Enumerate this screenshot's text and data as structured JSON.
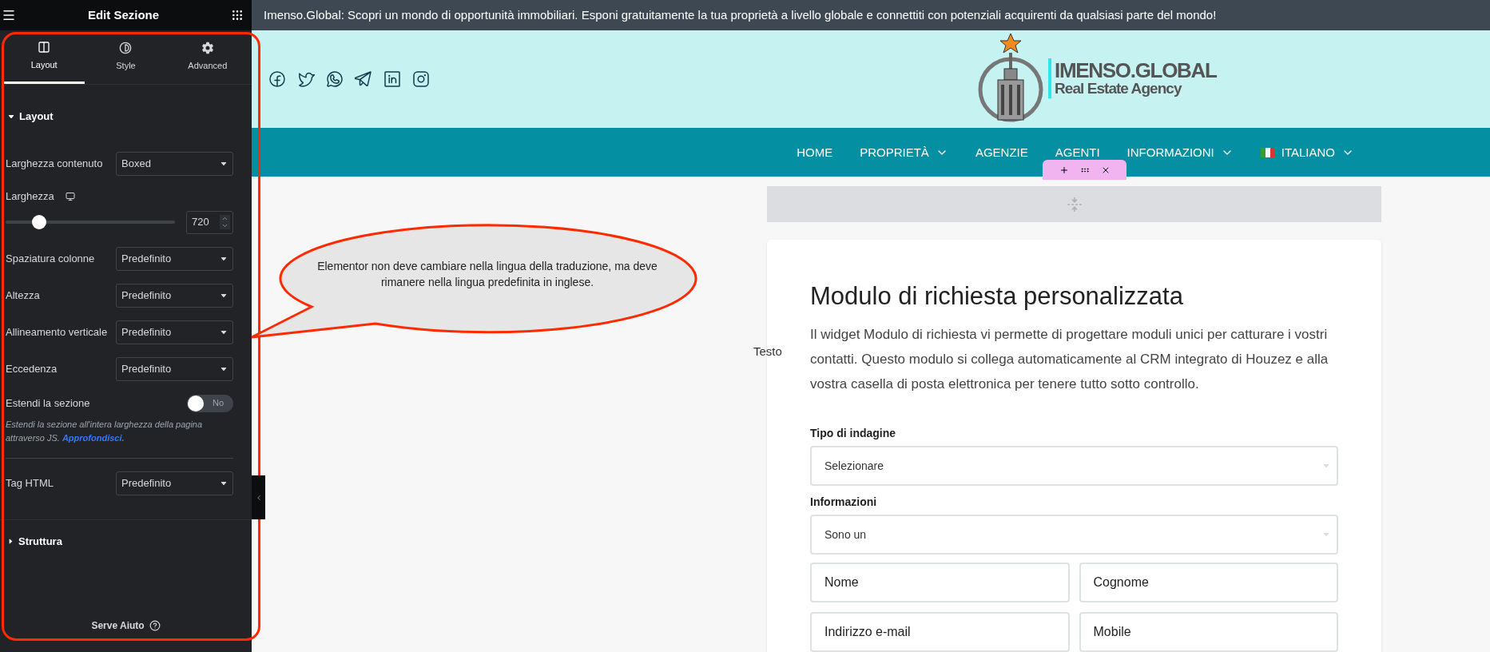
{
  "panel": {
    "title": "Edit Sezione",
    "tabs": [
      {
        "label": "Layout",
        "selected": true
      },
      {
        "label": "Style",
        "selected": false
      },
      {
        "label": "Advanced",
        "selected": false
      }
    ],
    "sections": [
      {
        "title": "Layout",
        "expanded": true,
        "controls": [
          {
            "kind": "select",
            "label": "Larghezza contenuto",
            "value": "Boxed"
          },
          {
            "kind": "slider",
            "label": "Larghezza",
            "level": 0.17,
            "value": "720"
          },
          {
            "kind": "select",
            "label": "Spaziatura colonne",
            "value": "Predefinito"
          },
          {
            "kind": "select",
            "label": "Altezza",
            "value": "Predefinito"
          },
          {
            "kind": "select",
            "label": "Allineamento verticale",
            "value": "Predefinito"
          },
          {
            "kind": "select",
            "label": "Eccedenza",
            "value": "Predefinito"
          },
          {
            "kind": "toggle",
            "label": "Estendi la sezione",
            "on": false,
            "state_text": "No"
          },
          {
            "kind": "note",
            "text": "Estendi la sezione all'intera larghezza della pagina attraverso JS.",
            "link": "Approfondisci."
          },
          {
            "kind": "select",
            "label": "Tag HTML",
            "value": "Predefinito"
          }
        ]
      },
      {
        "title": "Struttura",
        "expanded": false
      }
    ],
    "footer": "Serve Aiuto"
  },
  "site": {
    "announcement": "Imenso.Global: Scopri un mondo di opportunità immobiliari. Esponi gratuitamente la tua proprietà a livello globale e connettiti con potenziali acquirenti da qualsiasi parte del mondo!",
    "logo": {
      "name": "IMENSO.GLOBAL",
      "tagline": "Real Estate Agency"
    },
    "nav": [
      {
        "label": "HOME",
        "dropdown": false,
        "flag": false
      },
      {
        "label": "PROPRIETÀ",
        "dropdown": true,
        "flag": false
      },
      {
        "label": "AGENZIE",
        "dropdown": false,
        "flag": false
      },
      {
        "label": "AGENTI",
        "dropdown": false,
        "flag": false
      },
      {
        "label": "INFORMAZIONI",
        "dropdown": true,
        "flag": false
      },
      {
        "label": "ITALIANO",
        "dropdown": true,
        "flag": true
      }
    ],
    "widget_label": "Testo",
    "form": {
      "title": "Modulo di richiesta personalizzata",
      "description": "Il widget Modulo di richiesta vi permette di progettare moduli unici per catturare i vostri contatti. Questo modulo si collega automaticamente al CRM integrato di Houzez e alla vostra casella di posta elettronica per tenere tutto sotto controllo.",
      "fields": [
        {
          "kind": "select",
          "label": "Tipo di indagine",
          "placeholder": "Selezionare"
        },
        {
          "kind": "select",
          "label": "Informazioni",
          "placeholder": "Sono un"
        },
        {
          "kind": "pair",
          "placeholders": [
            "Nome",
            "Cognome"
          ]
        },
        {
          "kind": "pair",
          "placeholders": [
            "Indirizzo e-mail",
            "Mobile"
          ]
        }
      ]
    }
  },
  "annotation": {
    "text": "Elementor non deve cambiare nella lingua della traduzione, ma deve rimanere nella lingua predefinita in inglese."
  }
}
